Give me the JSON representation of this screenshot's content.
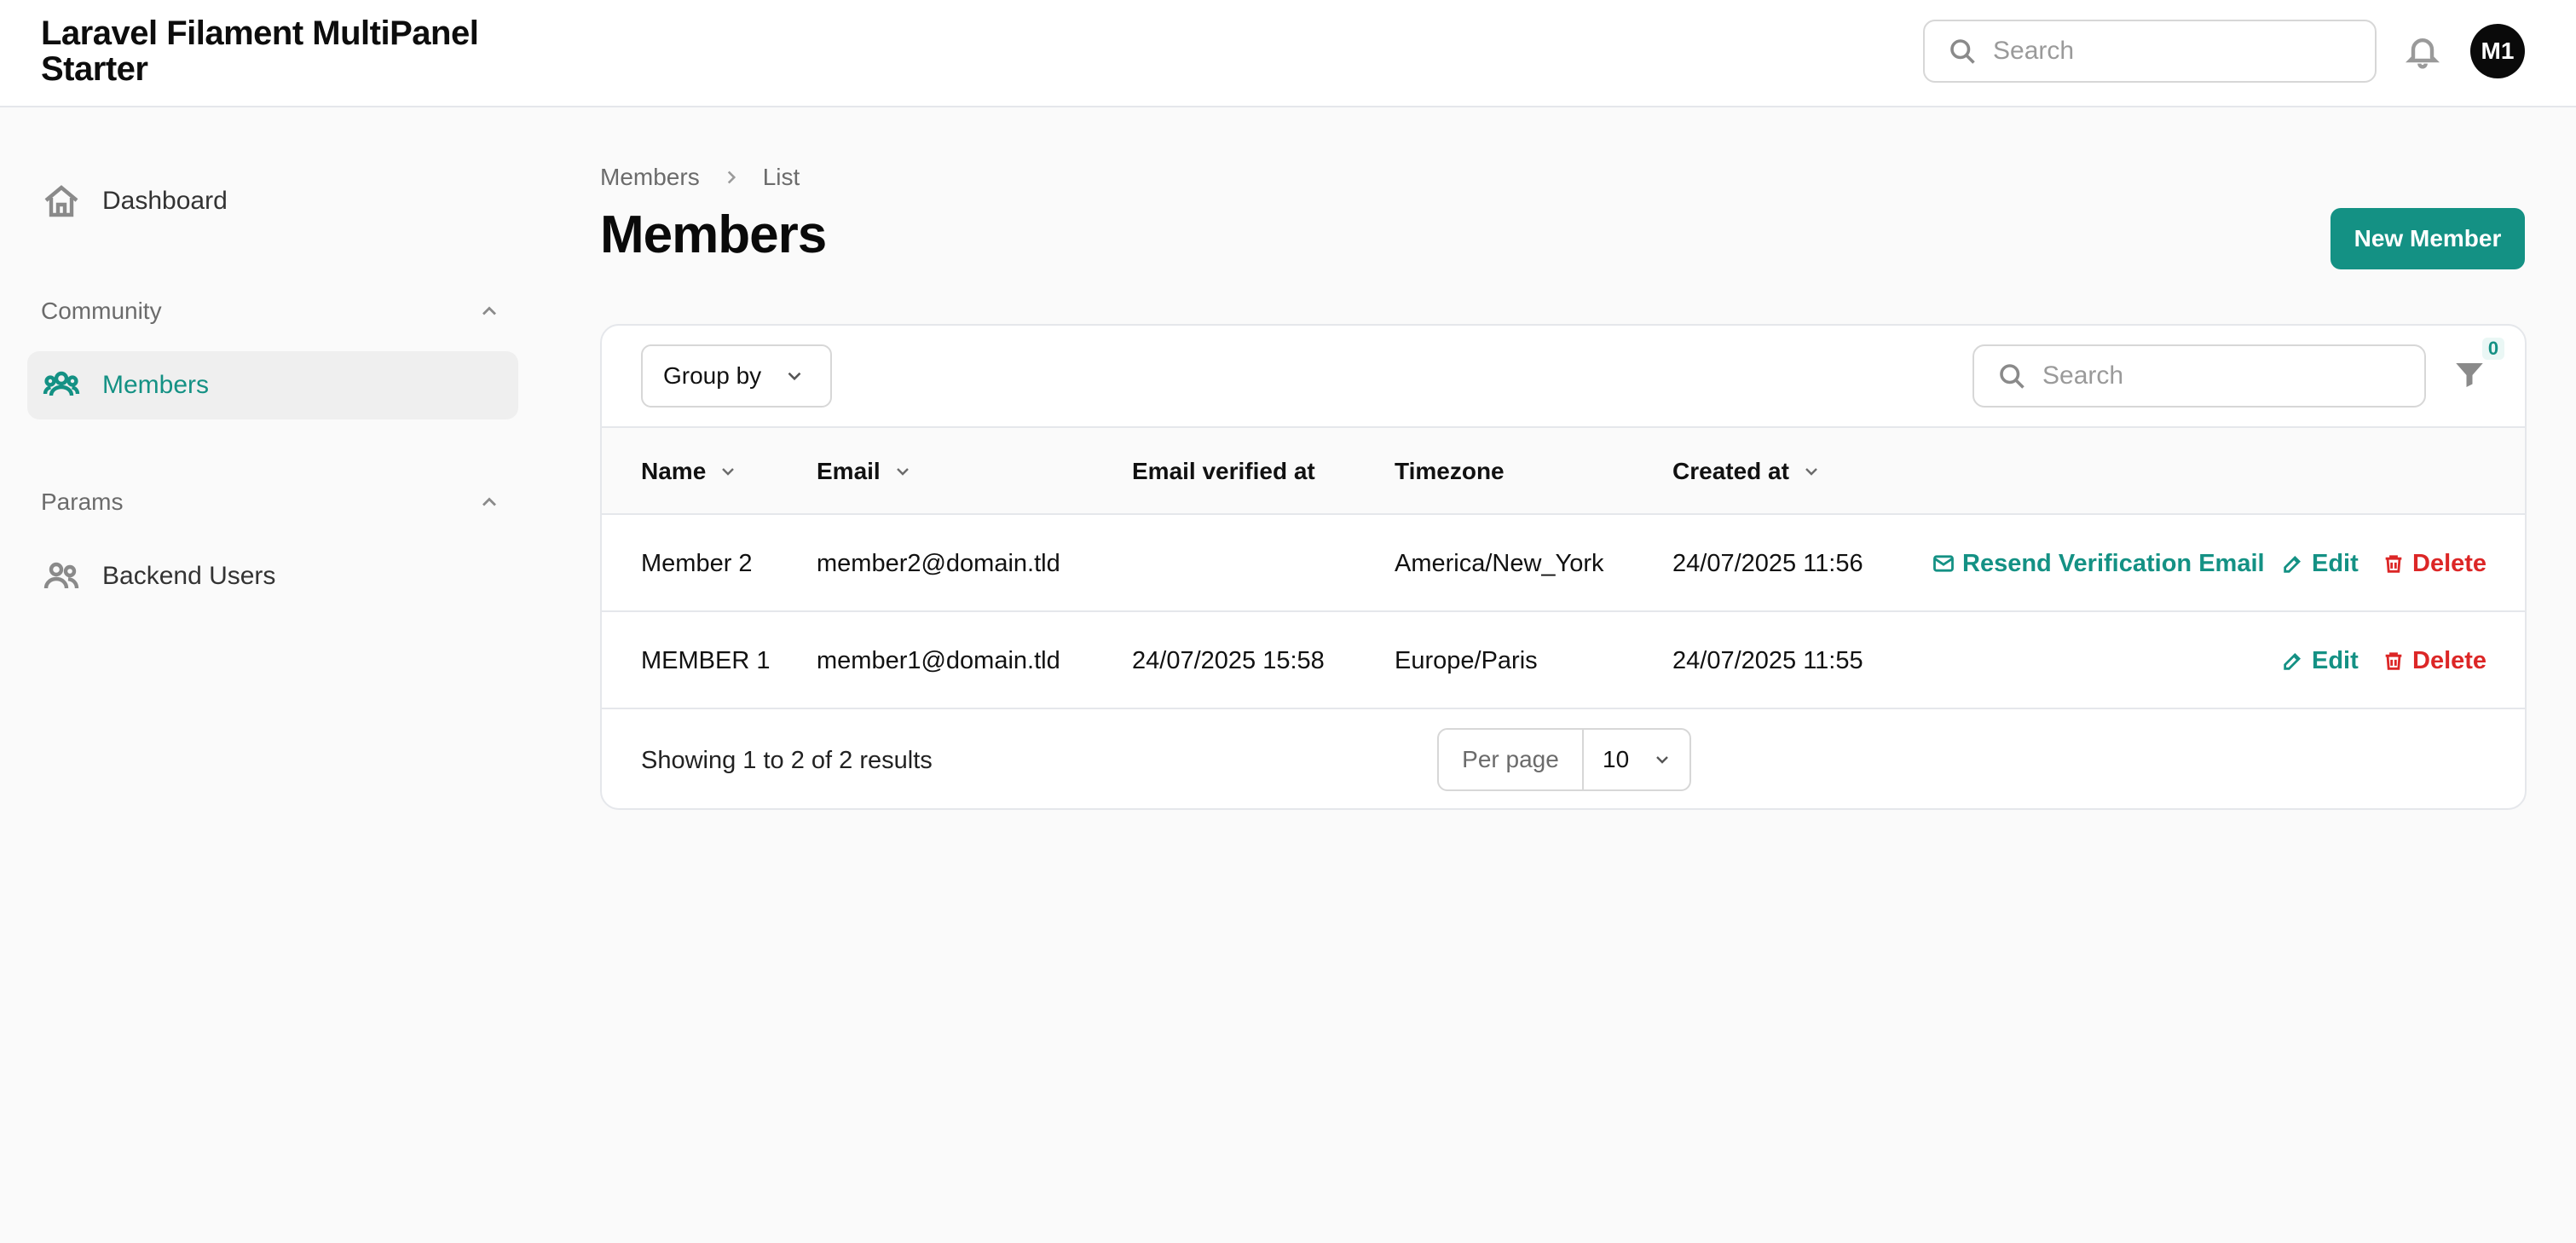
{
  "app": {
    "title": "Laravel Filament MultiPanel Starter"
  },
  "topbar": {
    "search_placeholder": "Search",
    "avatar_initials": "M1"
  },
  "sidebar": {
    "dashboard_label": "Dashboard",
    "groups": [
      {
        "label": "Community",
        "items": [
          {
            "label": "Members",
            "active": true
          }
        ]
      },
      {
        "label": "Params",
        "items": [
          {
            "label": "Backend Users",
            "active": false
          }
        ]
      }
    ]
  },
  "breadcrumb": {
    "items": [
      "Members",
      "List"
    ]
  },
  "page": {
    "title": "Members",
    "new_button": "New Member"
  },
  "table": {
    "group_by_label": "Group by",
    "search_placeholder": "Search",
    "filter_count": "0",
    "columns": [
      "Name",
      "Email",
      "Email verified at",
      "Timezone",
      "Created at"
    ],
    "rows": [
      {
        "name": "Member 2",
        "email": "member2@domain.tld",
        "email_verified_at": "",
        "timezone": "America/New_York",
        "created_at": "24/07/2025 11:56",
        "actions": [
          "Resend Verification Email",
          "Edit",
          "Delete"
        ]
      },
      {
        "name": "MEMBER 1",
        "email": "member1@domain.tld",
        "email_verified_at": "24/07/2025 15:58",
        "timezone": "Europe/Paris",
        "created_at": "24/07/2025 11:55",
        "actions": [
          "Edit",
          "Delete"
        ]
      }
    ],
    "footer": {
      "showing": "Showing 1 to 2 of 2 results",
      "per_page_label": "Per page",
      "per_page_value": "10"
    }
  },
  "colors": {
    "primary": "#149184",
    "danger": "#dc2626"
  },
  "icons": {
    "search": "search-icon",
    "bell": "bell-icon",
    "home": "home-icon",
    "users": "users-icon",
    "chevron_up": "chevron-up-icon",
    "chevron_down": "chevron-down-icon",
    "chevron_right": "chevron-right-icon",
    "filter": "filter-icon",
    "mail": "mail-icon",
    "edit": "edit-icon",
    "trash": "trash-icon"
  }
}
